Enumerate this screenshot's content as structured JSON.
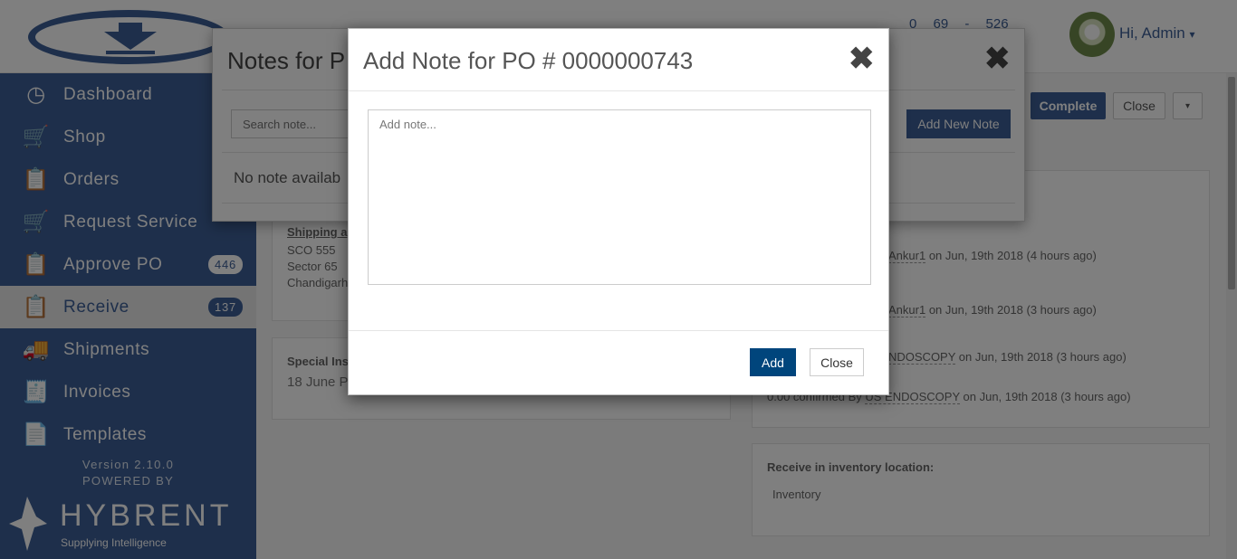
{
  "header": {
    "stats": [
      "0",
      "69",
      "-",
      "526"
    ],
    "greeting": "Hi, Admin",
    "caret": "▾"
  },
  "sidebar": {
    "items": [
      {
        "label": "Dashboard",
        "icon": "dashboard-icon",
        "glyph": "◷"
      },
      {
        "label": "Shop",
        "icon": "cart-icon",
        "glyph": "🛒"
      },
      {
        "label": "Orders",
        "icon": "orders-icon",
        "glyph": "📋"
      },
      {
        "label": "Request Service",
        "icon": "request-service-icon",
        "glyph": "🛒"
      },
      {
        "label": "Approve PO",
        "icon": "approve-icon",
        "glyph": "📋",
        "badge": "446"
      },
      {
        "label": "Receive",
        "icon": "receive-icon",
        "glyph": "📋",
        "badge": "137",
        "active": true
      },
      {
        "label": "Shipments",
        "icon": "truck-icon",
        "glyph": "🚚"
      },
      {
        "label": "Invoices",
        "icon": "invoice-icon",
        "glyph": "🧾"
      },
      {
        "label": "Templates",
        "icon": "template-icon",
        "glyph": "📄"
      }
    ],
    "version": "Version 2.10.0",
    "powered_by": "POWERED BY",
    "brand": "HYBRENT",
    "tagline": "Supplying Intelligence"
  },
  "toolbar": {
    "complete": "Complete",
    "close": "Close",
    "caret": "▾"
  },
  "shipping": {
    "title": "Shipping a",
    "lines": [
      "SCO 555",
      "Sector 65",
      "Chandigarh"
    ]
  },
  "special": {
    "title": "Special Ins",
    "value": "18 June P"
  },
  "history": [
    {
      "prefix": "",
      "user": "Ankur1",
      "suffix": " on Jun, 19th 2018 (4 hours ago)"
    },
    {
      "prefix": "",
      "user": "Ankur1",
      "suffix": " on Jun, 19th 2018 (3 hours ago)"
    },
    {
      "prefix": "",
      "user": "NDOSCOPY",
      "suffix": " on Jun, 19th 2018 (3 hours ago)"
    },
    {
      "prefix": "0.00 confirmed By ",
      "user": "US ENDOSCOPY",
      "suffix": " on Jun, 19th 2018 (3 hours ago)"
    }
  ],
  "receive_location": {
    "title": "Receive in inventory location:",
    "value": "Inventory"
  },
  "notes_modal": {
    "title": "Notes for P",
    "search_placeholder": "Search note...",
    "add_new": "Add New Note",
    "empty": "No note availab",
    "close_glyph": "✖"
  },
  "add_note_modal": {
    "title": "Add Note for PO # 0000000743",
    "placeholder": "Add note...",
    "value": "",
    "add_label": "Add",
    "close_label": "Close",
    "close_glyph": "✖"
  },
  "colors": {
    "brand": "#3d5f96",
    "primary_button": "#00457c"
  }
}
